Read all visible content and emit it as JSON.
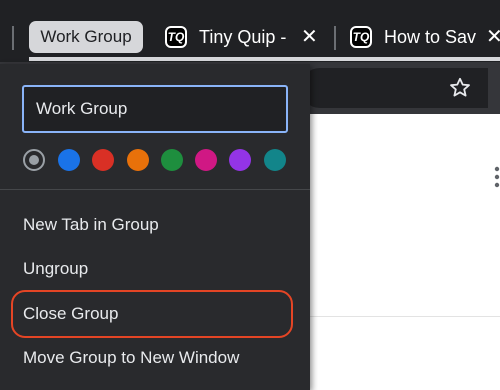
{
  "tab_strip": {
    "group_label": "Work Group",
    "group_color": "#d6d7da",
    "tabs": [
      {
        "favicon_text": "TQ",
        "title": "Tiny Quip -",
        "close_icon": "close-icon"
      },
      {
        "favicon_text": "TQ",
        "title": "How to Sav",
        "close_icon": "close-icon"
      }
    ]
  },
  "toolbar": {
    "bookmark_icon": "star-icon"
  },
  "menu": {
    "name_input_value": "Work Group",
    "colors": [
      {
        "name": "grey",
        "hex": "#9aa0a6",
        "selected": true
      },
      {
        "name": "blue",
        "hex": "#1a73e8"
      },
      {
        "name": "red",
        "hex": "#d93025"
      },
      {
        "name": "orange",
        "hex": "#e8710a"
      },
      {
        "name": "green",
        "hex": "#1e8e3e"
      },
      {
        "name": "pink",
        "hex": "#d01884"
      },
      {
        "name": "purple",
        "hex": "#9334e6"
      },
      {
        "name": "cyan",
        "hex": "#12858a"
      }
    ],
    "items": [
      {
        "label": "New Tab in Group"
      },
      {
        "label": "Ungroup"
      },
      {
        "label": "Close Group",
        "highlighted": true
      },
      {
        "label": "Move Group to New Window"
      }
    ],
    "highlight_color": "#e44525"
  }
}
